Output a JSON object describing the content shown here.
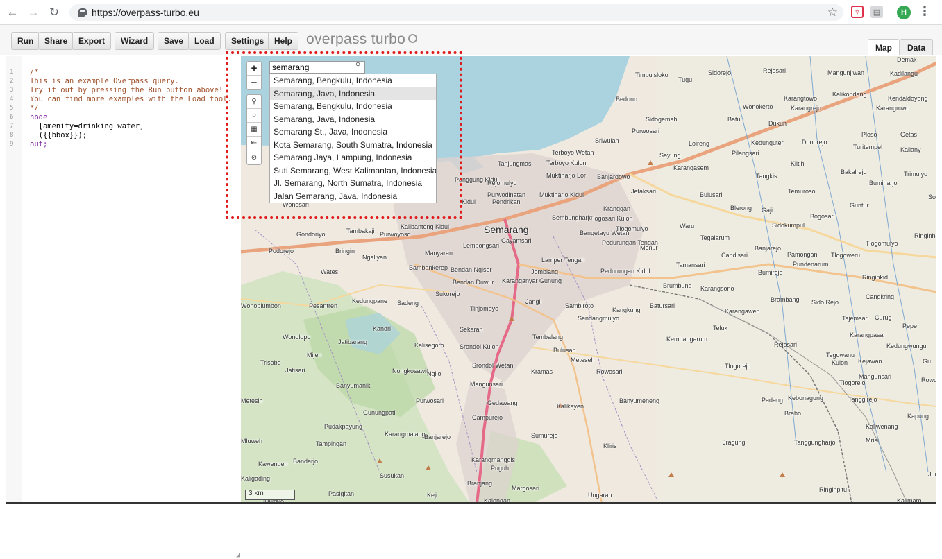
{
  "browser": {
    "url": "https://overpass-turbo.eu",
    "avatar_letter": "H"
  },
  "toolbar": {
    "run": "Run",
    "share": "Share",
    "export": "Export",
    "wizard": "Wizard",
    "save": "Save",
    "load": "Load",
    "settings": "Settings",
    "help": "Help",
    "brand": "overpass turbo"
  },
  "view_tabs": {
    "map": "Map",
    "data": "Data"
  },
  "editor": {
    "line_numbers": [
      "1",
      "2",
      "3",
      "4",
      "5",
      "6",
      "7",
      "8",
      "9"
    ],
    "lines": [
      "/*",
      "This is an example Overpass query.",
      "Try it out by pressing the Run button above!",
      "You can find more examples with the Load tool.",
      "*/",
      "node",
      "  [amenity=drinking_water]",
      "  ({{bbox}});",
      "out;"
    ]
  },
  "map": {
    "search_value": "semarang",
    "suggestions": [
      "Semarang, Bengkulu, Indonesia",
      "Semarang, Java, Indonesia",
      "Semarang, Bengkulu, Indonesia",
      "Semarang, Java, Indonesia",
      "Semarang St., Java, Indonesia",
      "Kota Semarang, South Sumatra, Indonesia",
      "Semarang Jaya, Lampung, Indonesia",
      "Suti Semarang, West Kalimantan, Indonesia",
      "Jl. Semarang, North Sumatra, Indonesia",
      "Jalan Semarang, Java, Indonesia"
    ],
    "hovered_index": 1,
    "scale": "3 km",
    "places": [
      {
        "name": "Semarang",
        "cls": "big"
      },
      {
        "name": "Timbulsloko"
      },
      {
        "name": "Tugu"
      },
      {
        "name": "Sidorejo"
      },
      {
        "name": "Rejosari"
      },
      {
        "name": "Mangunjiwan"
      },
      {
        "name": "Kadilangu"
      },
      {
        "name": "Demak"
      },
      {
        "name": "Bedono"
      },
      {
        "name": "Karangtowo"
      },
      {
        "name": "Kalikondang"
      },
      {
        "name": "Kendaldoyong"
      },
      {
        "name": "Wonokerto"
      },
      {
        "name": "Karangrejo"
      },
      {
        "name": "Karangrowo"
      },
      {
        "name": "Sidogemah"
      },
      {
        "name": "Batu"
      },
      {
        "name": "Dukun"
      },
      {
        "name": "Purwosari"
      },
      {
        "name": "Sriwulan"
      },
      {
        "name": "Terboyo Wetan"
      },
      {
        "name": "Terboyo Kulon"
      },
      {
        "name": "Tanjungmas"
      },
      {
        "name": "Sayung"
      },
      {
        "name": "Loireng"
      },
      {
        "name": "Kedunguter"
      },
      {
        "name": "Donorejo"
      },
      {
        "name": "Ploso"
      },
      {
        "name": "Getas"
      },
      {
        "name": "Turitempel"
      },
      {
        "name": "Kaliany"
      },
      {
        "name": "Pilangsari"
      },
      {
        "name": "Klitih"
      },
      {
        "name": "Karangasem"
      },
      {
        "name": "Muktiharjo Lor"
      },
      {
        "name": "Banjardowo"
      },
      {
        "name": "Tangkis"
      },
      {
        "name": "Bakalrejo"
      },
      {
        "name": "Trimulyo"
      },
      {
        "name": "Bumiharjo"
      },
      {
        "name": "Jetaksari"
      },
      {
        "name": "Bulusari"
      },
      {
        "name": "Temuroso"
      },
      {
        "name": "Guntur"
      },
      {
        "name": "Sol"
      },
      {
        "name": "Blerong"
      },
      {
        "name": "Gaji"
      },
      {
        "name": "Bogosari"
      },
      {
        "name": "Sidokumpul"
      },
      {
        "name": "Waru"
      },
      {
        "name": "Tegalarum"
      },
      {
        "name": "Ringinhar"
      },
      {
        "name": "Banjarejo"
      },
      {
        "name": "Candisari"
      },
      {
        "name": "Pamongan"
      },
      {
        "name": "Tlogoweru"
      },
      {
        "name": "Tlogomulyo"
      },
      {
        "name": "Pundenarum"
      },
      {
        "name": "Tamansari"
      },
      {
        "name": "Menur"
      },
      {
        "name": "Bumirejo"
      },
      {
        "name": "Ringinkid"
      },
      {
        "name": "Tunjungharjo"
      },
      {
        "name": "Brumbung"
      },
      {
        "name": "Karangsono"
      },
      {
        "name": "Brambang"
      },
      {
        "name": "Sido Rejo"
      },
      {
        "name": "Cangkring"
      },
      {
        "name": "Batursari"
      },
      {
        "name": "Karangawen"
      },
      {
        "name": "Tajemsari"
      },
      {
        "name": "Curug"
      },
      {
        "name": "Pepe"
      },
      {
        "name": "Teluk"
      },
      {
        "name": "Kembangarum"
      },
      {
        "name": "Karangpasar"
      },
      {
        "name": "Rejosari"
      },
      {
        "name": "Kedungwungu"
      },
      {
        "name": "Tegowanu"
      },
      {
        "name": "Kulon"
      },
      {
        "name": "Kejawan"
      },
      {
        "name": "Gu"
      },
      {
        "name": "Tlogorejo"
      },
      {
        "name": "Mangunsari"
      },
      {
        "name": "Rowosar"
      },
      {
        "name": "Tlogorejo"
      },
      {
        "name": "Padang"
      },
      {
        "name": "Kebonagung"
      },
      {
        "name": "Tanggirejo"
      },
      {
        "name": "Brabo"
      },
      {
        "name": "Kapung"
      },
      {
        "name": "Kaliwenang"
      },
      {
        "name": "Tanggungharjo"
      },
      {
        "name": "Mrisi"
      },
      {
        "name": "Ng"
      },
      {
        "name": "Jragung"
      },
      {
        "name": "Jumo"
      },
      {
        "name": "Ringinpitu"
      },
      {
        "name": "Kalimaro"
      },
      {
        "name": "Wonosari"
      },
      {
        "name": "Tambakaji"
      },
      {
        "name": "Kalibanteng Kidul"
      },
      {
        "name": "Purwoyoso"
      },
      {
        "name": "Gondoriyo"
      },
      {
        "name": "Podorejo"
      },
      {
        "name": "Bringin"
      },
      {
        "name": "Ngaliyan"
      },
      {
        "name": "Manyaran"
      },
      {
        "name": "Lempongsari"
      },
      {
        "name": "Gayamsari"
      },
      {
        "name": "Pedurungan Tengah"
      },
      {
        "name": "Lamper Tengah"
      },
      {
        "name": "Bambankerep"
      },
      {
        "name": "Bendan Ngisor"
      },
      {
        "name": "Jomblang"
      },
      {
        "name": "Pedurungan Kidul"
      },
      {
        "name": "Wates"
      },
      {
        "name": "Bendan Duwur"
      },
      {
        "name": "Karanganyar Gunung"
      },
      {
        "name": "Sukorejo"
      },
      {
        "name": "Jangli"
      },
      {
        "name": "Sambiroto"
      },
      {
        "name": "Kangkung"
      },
      {
        "name": "Sendangmulyo"
      },
      {
        "name": "Pesantren"
      },
      {
        "name": "Kedungpane"
      },
      {
        "name": "Sadeng"
      },
      {
        "name": "Tinjomoyo"
      },
      {
        "name": "Wonoplumbon"
      },
      {
        "name": "Kandri"
      },
      {
        "name": "Sekaran"
      },
      {
        "name": "Wonolopo"
      },
      {
        "name": "Tembalang"
      },
      {
        "name": "Jatibarang"
      },
      {
        "name": "Kalisegoro"
      },
      {
        "name": "Srondol Kulon"
      },
      {
        "name": "Bulusan"
      },
      {
        "name": "Mijen"
      },
      {
        "name": "Meteseh"
      },
      {
        "name": "Trisobo"
      },
      {
        "name": "Srondol Wetan"
      },
      {
        "name": "Jatisari"
      },
      {
        "name": "Nongkosawit"
      },
      {
        "name": "Ngijo"
      },
      {
        "name": "Kramas"
      },
      {
        "name": "Rowosari"
      },
      {
        "name": "Banyumanik"
      },
      {
        "name": "Purwosari"
      },
      {
        "name": "Mangunsari"
      },
      {
        "name": "Gedawang"
      },
      {
        "name": "Banyumeneng"
      },
      {
        "name": "Metesih"
      },
      {
        "name": "Kalikayen"
      },
      {
        "name": "Gunungpati"
      },
      {
        "name": "Campurejo"
      },
      {
        "name": "Pudakpayung"
      },
      {
        "name": "Karangmalang"
      },
      {
        "name": "Banjarejo"
      },
      {
        "name": "Sumurejo"
      },
      {
        "name": "Mluweh"
      },
      {
        "name": "Tampingan"
      },
      {
        "name": "Kliris"
      },
      {
        "name": "Kawengen"
      },
      {
        "name": "Bandarjo"
      },
      {
        "name": "Karangmanggis"
      },
      {
        "name": "Puguh"
      },
      {
        "name": "Susukan"
      },
      {
        "name": "Branjang"
      },
      {
        "name": "Kaligading"
      },
      {
        "name": "Pasigitan"
      },
      {
        "name": "Keji"
      },
      {
        "name": "Ungaran"
      },
      {
        "name": "Kalongan"
      },
      {
        "name": "Kalirejo"
      },
      {
        "name": "Margosari"
      },
      {
        "name": "Genuk"
      },
      {
        "name": "Panggung Kidul"
      },
      {
        "name": "Rejomulyo"
      },
      {
        "name": "Purwodinatan"
      },
      {
        "name": "Muktiharjo Kidul"
      },
      {
        "name": "Kidul"
      },
      {
        "name": "Pendrikan"
      },
      {
        "name": "Kranggan"
      },
      {
        "name": "Sembungharjo"
      },
      {
        "name": "Tlogosari Kulon"
      },
      {
        "name": "Bangetayu Wetan"
      },
      {
        "name": "Tlogomulyo"
      },
      {
        "name": "Kidul"
      }
    ]
  }
}
